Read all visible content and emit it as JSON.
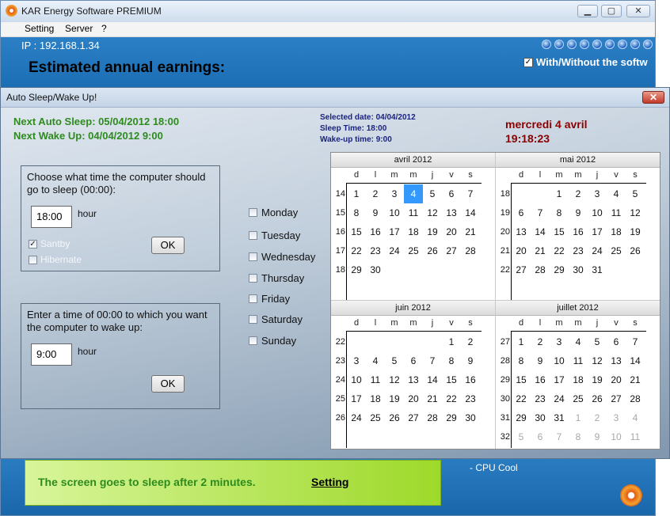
{
  "main_window": {
    "title": "KAR Energy Software PREMIUM",
    "menu": [
      "Setting",
      "Server",
      "?"
    ],
    "ip": "IP : 192.168.1.34",
    "earnings_title": "Estimated annual earnings:",
    "with_without": "With/Without the softw",
    "sleep_notice": "The screen goes to sleep after 2 minutes.",
    "setting_link": "Setting",
    "cpu_cool": "- CPU Cool"
  },
  "dialog": {
    "title": "Auto Sleep/Wake Up!",
    "next_sleep": "Next Auto Sleep: 05/04/2012 18:00",
    "next_wake": "Next Wake Up: 04/04/2012 9:00",
    "selected_date": "Selected date: 04/04/2012",
    "sleep_time": "Sleep Time: 18:00",
    "wake_time": "Wake-up time: 9:00",
    "clock_date": "mercredi 4 avril",
    "clock_time": "19:18:23",
    "sleep_group": {
      "prompt": "Choose what time the computer should go to sleep (00:00):",
      "value": "18:00",
      "unit": "hour",
      "standby_label": "Santby",
      "hibernate_label": "Hibernate",
      "ok": "OK"
    },
    "wake_group": {
      "prompt": "Enter a time of 00:00 to which you want the computer to wake up:",
      "value": "9:00",
      "unit": "hour",
      "ok": "OK"
    },
    "days": [
      "Monday",
      "Tuesday",
      "Wednesday",
      "Thursday",
      "Friday",
      "Saturday",
      "Sunday"
    ],
    "calendar": {
      "day_names": [
        "d",
        "l",
        "m",
        "m",
        "j",
        "v",
        "s"
      ],
      "months": [
        {
          "name": "avril 2012",
          "weeks": [
            {
              "n": "14",
              "days": [
                "1",
                "2",
                "3",
                "4",
                "5",
                "6",
                "7"
              ]
            },
            {
              "n": "15",
              "days": [
                "8",
                "9",
                "10",
                "11",
                "12",
                "13",
                "14"
              ]
            },
            {
              "n": "16",
              "days": [
                "15",
                "16",
                "17",
                "18",
                "19",
                "20",
                "21"
              ]
            },
            {
              "n": "17",
              "days": [
                "22",
                "23",
                "24",
                "25",
                "26",
                "27",
                "28"
              ]
            },
            {
              "n": "18",
              "days": [
                "29",
                "30",
                "",
                "",
                "",
                "",
                ""
              ]
            }
          ]
        },
        {
          "name": "mai 2012",
          "weeks": [
            {
              "n": "18",
              "days": [
                "",
                "",
                "1",
                "2",
                "3",
                "4",
                "5"
              ]
            },
            {
              "n": "19",
              "days": [
                "6",
                "7",
                "8",
                "9",
                "10",
                "11",
                "12"
              ]
            },
            {
              "n": "20",
              "days": [
                "13",
                "14",
                "15",
                "16",
                "17",
                "18",
                "19"
              ]
            },
            {
              "n": "21",
              "days": [
                "20",
                "21",
                "22",
                "23",
                "24",
                "25",
                "26"
              ]
            },
            {
              "n": "22",
              "days": [
                "27",
                "28",
                "29",
                "30",
                "31",
                "",
                ""
              ]
            }
          ]
        },
        {
          "name": "juin 2012",
          "weeks": [
            {
              "n": "22",
              "days": [
                "",
                "",
                "",
                "",
                "",
                "1",
                "2"
              ]
            },
            {
              "n": "23",
              "days": [
                "3",
                "4",
                "5",
                "6",
                "7",
                "8",
                "9"
              ]
            },
            {
              "n": "24",
              "days": [
                "10",
                "11",
                "12",
                "13",
                "14",
                "15",
                "16"
              ]
            },
            {
              "n": "25",
              "days": [
                "17",
                "18",
                "19",
                "20",
                "21",
                "22",
                "23"
              ]
            },
            {
              "n": "26",
              "days": [
                "24",
                "25",
                "26",
                "27",
                "28",
                "29",
                "30"
              ]
            }
          ]
        },
        {
          "name": "juillet 2012",
          "weeks": [
            {
              "n": "27",
              "days": [
                "1",
                "2",
                "3",
                "4",
                "5",
                "6",
                "7"
              ]
            },
            {
              "n": "28",
              "days": [
                "8",
                "9",
                "10",
                "11",
                "12",
                "13",
                "14"
              ]
            },
            {
              "n": "29",
              "days": [
                "15",
                "16",
                "17",
                "18",
                "19",
                "20",
                "21"
              ]
            },
            {
              "n": "30",
              "days": [
                "22",
                "23",
                "24",
                "25",
                "26",
                "27",
                "28"
              ]
            },
            {
              "n": "31",
              "days": [
                "29",
                "30",
                "31",
                "1",
                "2",
                "3",
                "4"
              ],
              "gray_from": 3
            },
            {
              "n": "32",
              "days": [
                "5",
                "6",
                "7",
                "8",
                "9",
                "10",
                "11"
              ],
              "gray_from": 0
            }
          ]
        }
      ],
      "selected": {
        "month": 0,
        "week": 0,
        "day": 3
      }
    }
  },
  "colors": {
    "green_text": "#2e8b1e",
    "navy_text": "#1a237e",
    "dark_red": "#8b0000",
    "accent_blue": "#1d6fb5"
  }
}
